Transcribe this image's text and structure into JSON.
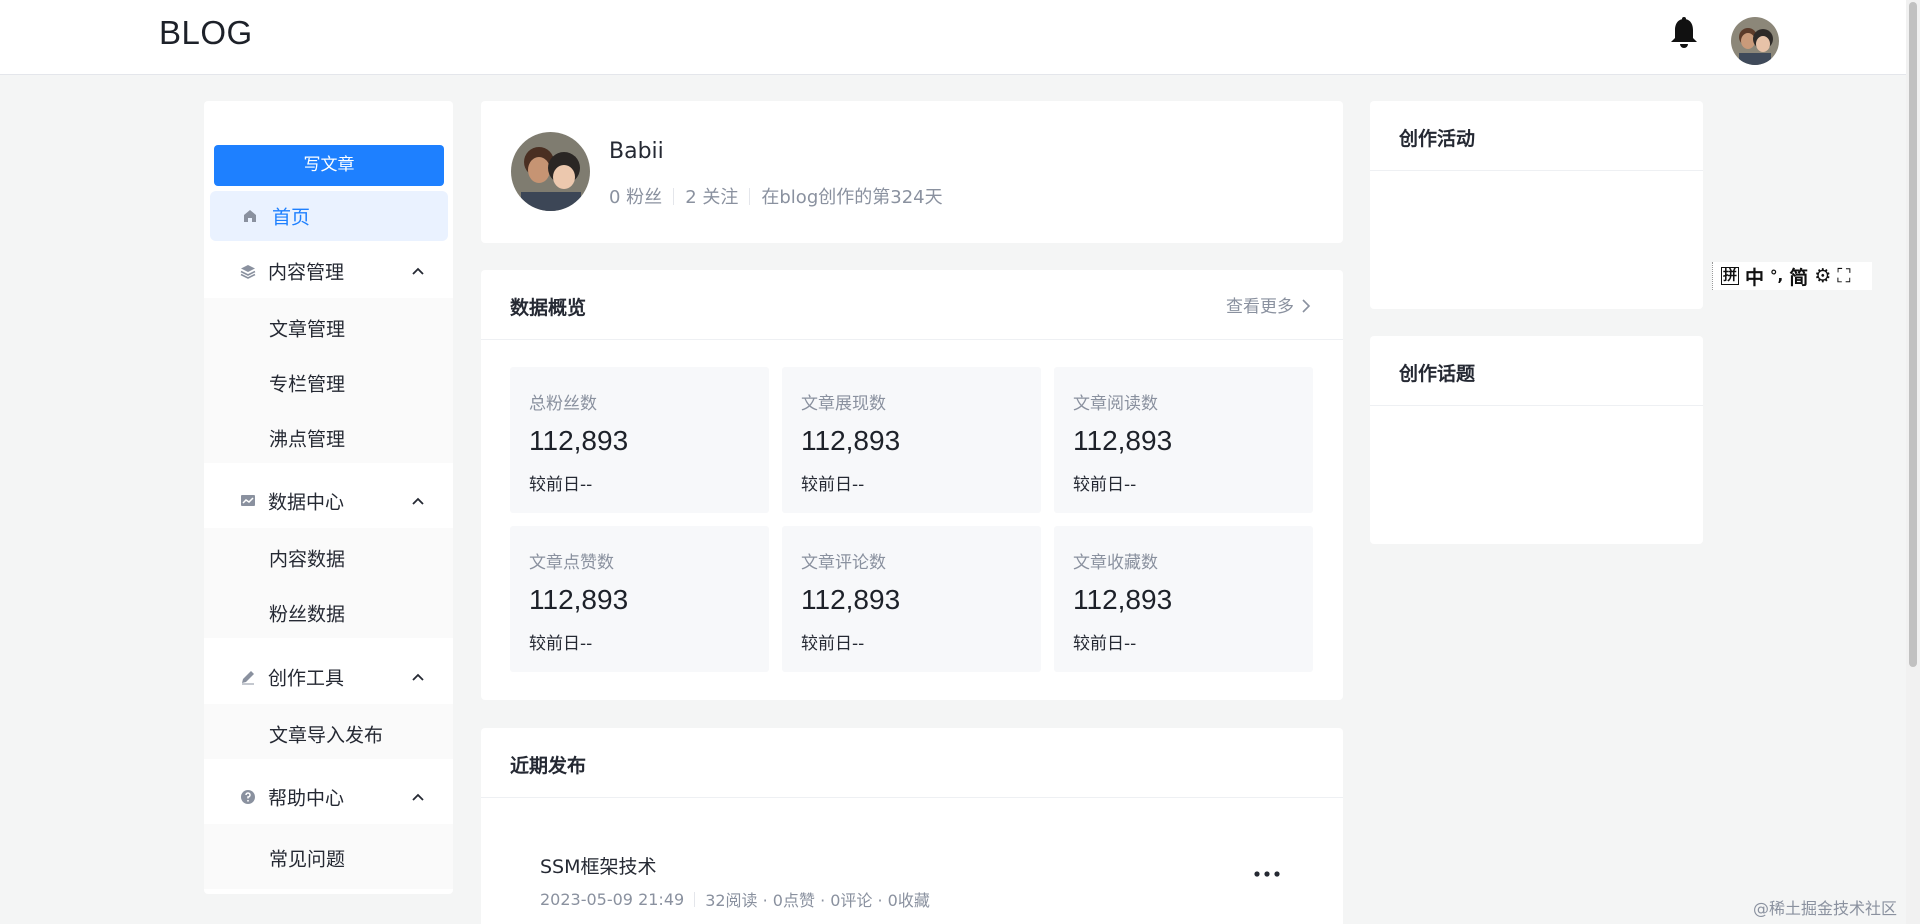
{
  "header": {
    "logo": "BLOG",
    "bell_icon": "bell-icon",
    "avatar_icon": "user-avatar"
  },
  "sidebar": {
    "write_button": "写文章",
    "home": {
      "label": "首页",
      "icon": "home-icon"
    },
    "groups": [
      {
        "label": "内容管理",
        "icon": "layers-icon",
        "items": [
          "文章管理",
          "专栏管理",
          "沸点管理"
        ]
      },
      {
        "label": "数据中心",
        "icon": "chart-icon",
        "items": [
          "内容数据",
          "粉丝数据"
        ]
      },
      {
        "label": "创作工具",
        "icon": "pen-icon",
        "items": [
          "文章导入发布"
        ]
      },
      {
        "label": "帮助中心",
        "icon": "help-icon",
        "items": [
          "常见问题"
        ]
      }
    ]
  },
  "profile": {
    "name": "Babii",
    "followers": "0 粉丝",
    "following": "2 关注",
    "days": "在blog创作的第324天"
  },
  "overview": {
    "title": "数据概览",
    "see_more": "查看更多",
    "stats": [
      {
        "label": "总粉丝数",
        "value": "112,893",
        "change": "较前日--"
      },
      {
        "label": "文章展现数",
        "value": "112,893",
        "change": "较前日--"
      },
      {
        "label": "文章阅读数",
        "value": "112,893",
        "change": "较前日--"
      },
      {
        "label": "文章点赞数",
        "value": "112,893",
        "change": "较前日--"
      },
      {
        "label": "文章评论数",
        "value": "112,893",
        "change": "较前日--"
      },
      {
        "label": "文章收藏数",
        "value": "112,893",
        "change": "较前日--"
      }
    ]
  },
  "recent": {
    "title": "近期发布",
    "posts": [
      {
        "title": "SSM框架技术",
        "date": "2023-05-09 21:49",
        "stats": "32阅读 · 0点赞 · 0评论 · 0收藏"
      }
    ]
  },
  "right": {
    "activity_title": "创作活动",
    "topics_title": "创作话题"
  },
  "ime": [
    "拼",
    "中",
    "°,",
    "简",
    "⚙",
    "⛶"
  ],
  "watermark": "@稀土掘金技术社区",
  "colors": {
    "accent": "#1e80ff",
    "page_bg": "#f4f5f5",
    "muted": "#8a919f"
  }
}
